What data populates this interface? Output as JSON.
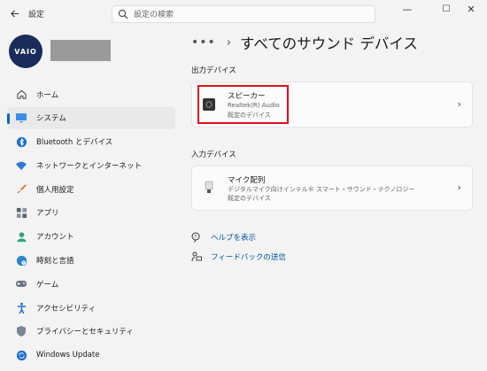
{
  "titlebar": {
    "back_icon": "arrow-left-icon",
    "app_title": "設定",
    "search_placeholder": "設定の検索",
    "minimize_label": "—",
    "maximize_label": "☐",
    "close_label": "✕"
  },
  "profile": {
    "logo_text": "VAIO"
  },
  "sidebar": {
    "items": [
      {
        "label": "ホーム",
        "icon": "home-icon"
      },
      {
        "label": "システム",
        "icon": "system-display-icon",
        "selected": true
      },
      {
        "label": "Bluetooth とデバイス",
        "icon": "bluetooth-icon"
      },
      {
        "label": "ネットワークとインターネット",
        "icon": "wifi-icon"
      },
      {
        "label": "個人用設定",
        "icon": "paintbrush-icon"
      },
      {
        "label": "アプリ",
        "icon": "apps-icon"
      },
      {
        "label": "アカウント",
        "icon": "account-icon"
      },
      {
        "label": "時刻と言語",
        "icon": "globe-clock-icon"
      },
      {
        "label": "ゲーム",
        "icon": "gamepad-icon"
      },
      {
        "label": "アクセシビリティ",
        "icon": "accessibility-icon"
      },
      {
        "label": "プライバシーとセキュリティ",
        "icon": "shield-icon"
      },
      {
        "label": "Windows Update",
        "icon": "update-icon"
      }
    ]
  },
  "breadcrumb": {
    "more": "•••",
    "separator": "›",
    "title": "すべてのサウンド デバイス"
  },
  "output": {
    "section_label": "出力デバイス",
    "device": {
      "name": "スピーカー",
      "driver": "Realtek(R) Audio",
      "status": "既定のデバイス",
      "icon": "speaker-icon"
    }
  },
  "input": {
    "section_label": "入力デバイス",
    "device": {
      "name": "マイク配列",
      "driver": "デジタルマイク向けインテル® スマート・サウンド・テクノロジー",
      "status": "既定のデバイス",
      "icon": "microphone-icon"
    }
  },
  "links": {
    "help": "ヘルプを表示",
    "feedback": "フィードバックの送信"
  },
  "colors": {
    "accent": "#0067c0",
    "highlight": "#e0101c"
  }
}
